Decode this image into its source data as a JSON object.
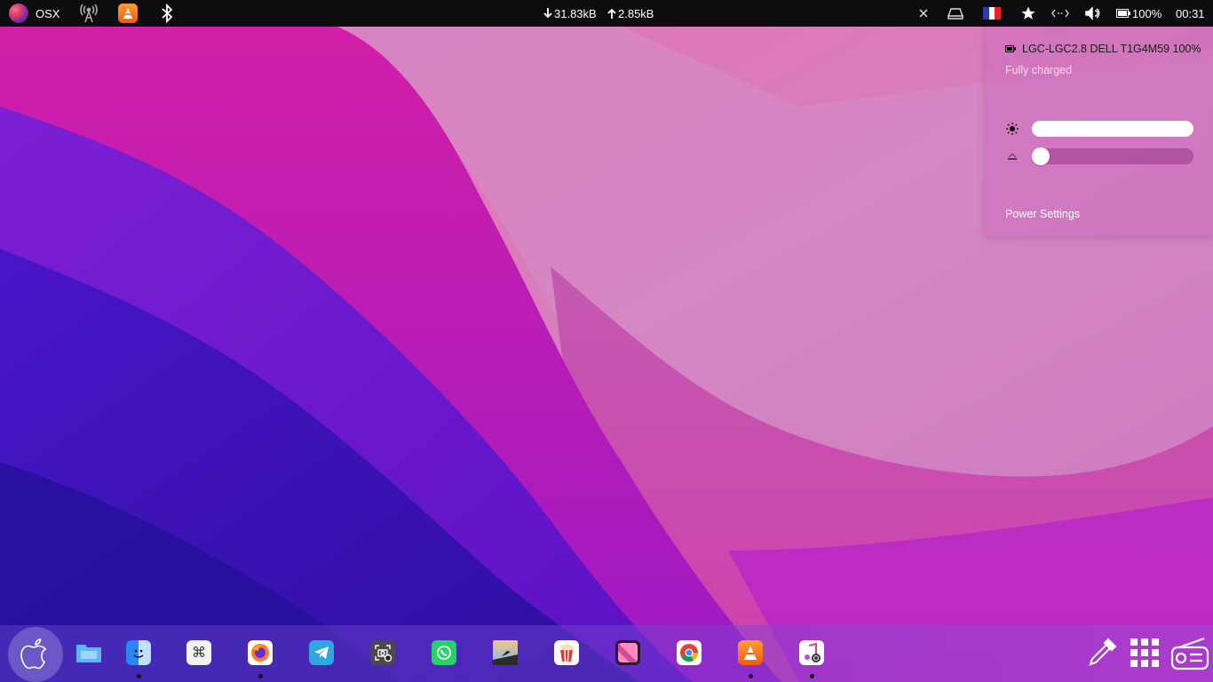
{
  "topbar": {
    "menu_label": "OSX",
    "download_speed": "31.83kB",
    "upload_speed": "2.85kB",
    "battery_percent": "100%",
    "clock": "00:31"
  },
  "power_popup": {
    "device_label": "LGC-LGC2.8 DELL T1G4M59 100%",
    "status": "Fully charged",
    "brightness_level": 1.0,
    "keyboard_backlight_level": 0.0,
    "settings_label": "Power Settings"
  },
  "dock": {
    "apps": [
      "files",
      "finder",
      "launchpad",
      "firefox",
      "telegram",
      "screenshot",
      "whatsapp",
      "photos",
      "popcorn-time",
      "affinity",
      "chrome",
      "vlc",
      "music"
    ]
  },
  "colors": {
    "topbar": "#0d0d10",
    "popup": "#cd6ebe",
    "accent": "#ffffff"
  }
}
